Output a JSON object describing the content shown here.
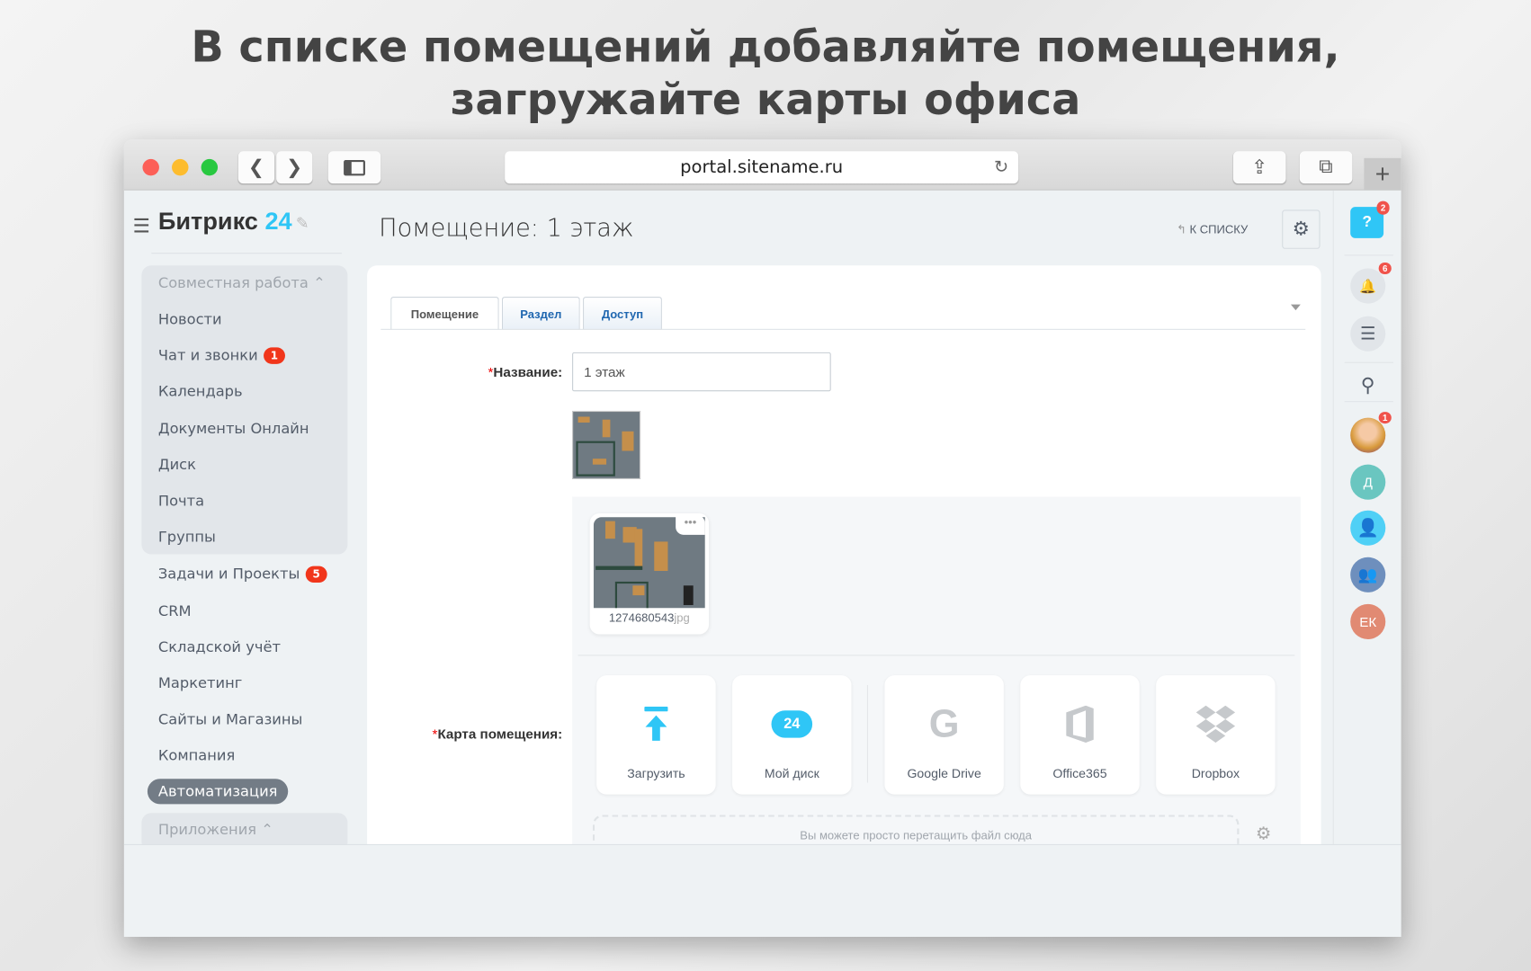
{
  "headline": {
    "line1": "В списке помещений добавляйте помещения,",
    "line2": "загружайте карты офиса"
  },
  "browser": {
    "url": "portal.sitename.ru"
  },
  "logo": {
    "name": "Битрикс",
    "num": "24"
  },
  "sidebar": {
    "group1": "Совместная работа",
    "items": [
      {
        "label": "Новости"
      },
      {
        "label": "Чат и звонки",
        "badge": "1"
      },
      {
        "label": "Календарь"
      },
      {
        "label": "Документы Онлайн"
      },
      {
        "label": "Диск"
      },
      {
        "label": "Почта"
      },
      {
        "label": "Группы"
      },
      {
        "label": "Задачи и Проекты",
        "badge": "5"
      },
      {
        "label": "CRM"
      },
      {
        "label": "Складской учёт"
      },
      {
        "label": "Маркетинг"
      },
      {
        "label": "Сайты и Магазины"
      },
      {
        "label": "Компания"
      },
      {
        "label": "Автоматизация"
      }
    ],
    "group2": "Приложения"
  },
  "page": {
    "title": "Помещение: 1 этаж",
    "back": "К СПИСКУ"
  },
  "tabs": [
    "Помещение",
    "Раздел",
    "Доступ"
  ],
  "form": {
    "name_label": "Название:",
    "name_value": "1 этаж",
    "map_label": "Карта помещения:",
    "file_name": "1274680543",
    "file_ext": "jpg",
    "dropzone": "Вы можете просто перетащить файл сюда"
  },
  "sources": [
    "Загрузить",
    "Мой диск",
    "Google Drive",
    "Office365",
    "Dropbox"
  ],
  "disk_num": "24",
  "rail": {
    "help_badge": "2",
    "bell_badge": "6",
    "avatar_badge": "1",
    "user_d": "Д",
    "user_ek": "ЕК"
  },
  "colors": {
    "accent": "#2fc6f6",
    "badge": "#f1361b"
  }
}
